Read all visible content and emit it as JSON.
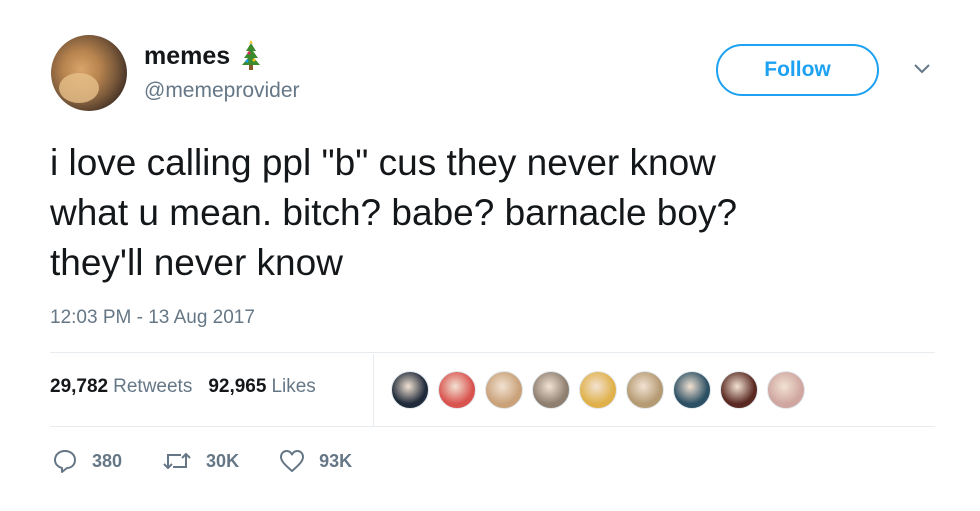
{
  "user": {
    "name": "memes",
    "handle": "@memeprovider",
    "emoji": "christmas-tree-icon"
  },
  "follow_label": "Follow",
  "tweet": {
    "lines": [
      "i love calling ppl \"b\" cus they never know",
      "what u mean. bitch? babe? barnacle boy?",
      "they'll never know"
    ],
    "timestamp": "12:03 PM - 13 Aug 2017"
  },
  "stats": {
    "retweets_count": "29,782",
    "retweets_label": "Retweets",
    "likes_count": "92,965",
    "likes_label": "Likes"
  },
  "likers": [
    {
      "name": "liker-avatar-1",
      "color": "#1f2a3a"
    },
    {
      "name": "liker-avatar-2",
      "color": "#d9534f"
    },
    {
      "name": "liker-avatar-3",
      "color": "#c9a27a"
    },
    {
      "name": "liker-avatar-4",
      "color": "#8e7f71"
    },
    {
      "name": "liker-avatar-5",
      "color": "#e0b14a"
    },
    {
      "name": "liker-avatar-6",
      "color": "#b59b74"
    },
    {
      "name": "liker-avatar-7",
      "color": "#2b4f63"
    },
    {
      "name": "liker-avatar-8",
      "color": "#5a2a22"
    },
    {
      "name": "liker-avatar-9",
      "color": "#cfa6a0"
    }
  ],
  "actions": {
    "replies": "380",
    "retweets": "30K",
    "likes": "93K"
  },
  "colors": {
    "accent": "#1da1f2",
    "muted": "#657786",
    "text": "#14171a"
  }
}
